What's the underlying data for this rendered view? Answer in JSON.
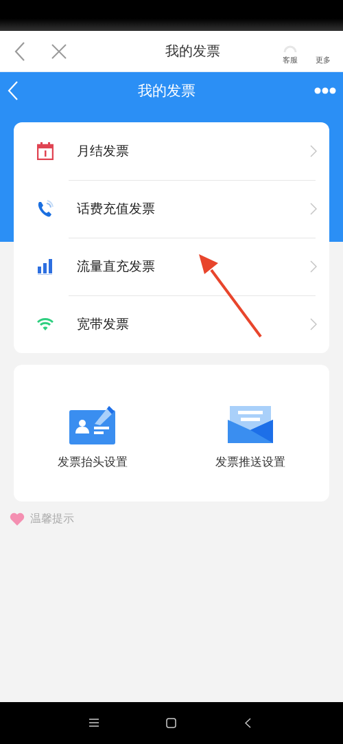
{
  "browser_bar": {
    "title": "我的发票",
    "actions": [
      {
        "label": "客服",
        "kind": "service"
      },
      {
        "label": "更多",
        "kind": "more"
      }
    ]
  },
  "app_bar": {
    "title": "我的发票"
  },
  "invoice_types": [
    {
      "label": "月结发票",
      "kind": "calendar"
    },
    {
      "label": "话费充值发票",
      "kind": "phone"
    },
    {
      "label": "流量直充发票",
      "kind": "bars"
    },
    {
      "label": "宽带发票",
      "kind": "wifi"
    }
  ],
  "settings": [
    {
      "label": "发票抬头设置",
      "kind": "card"
    },
    {
      "label": "发票推送设置",
      "kind": "mail"
    }
  ],
  "tip": {
    "label": "温馨提示"
  }
}
